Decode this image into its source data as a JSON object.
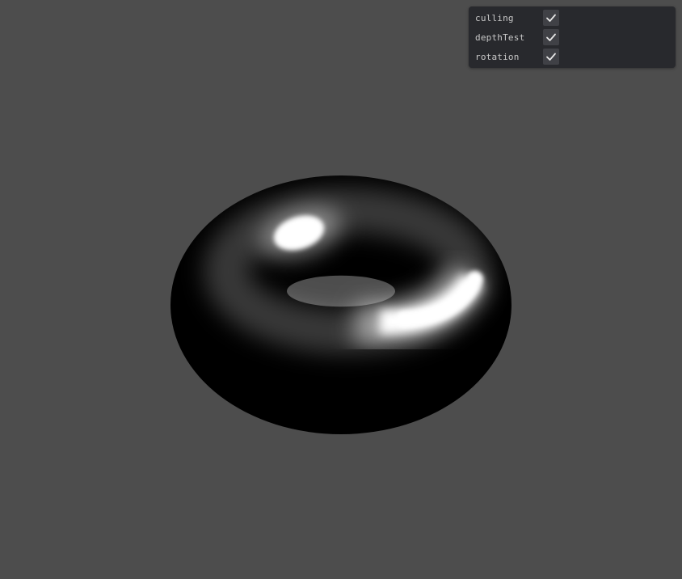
{
  "gui": {
    "controls": [
      {
        "label": "culling",
        "checked": true
      },
      {
        "label": "depthTest",
        "checked": true
      },
      {
        "label": "rotation",
        "checked": false
      }
    ]
  },
  "colors": {
    "background": "#4d4d4d",
    "panel": "#28292d",
    "checkbox": "#404146",
    "text": "#c8c8c8",
    "torus": "#000000",
    "highlight": "#ffffff"
  },
  "icons": {
    "check": "check-icon"
  }
}
